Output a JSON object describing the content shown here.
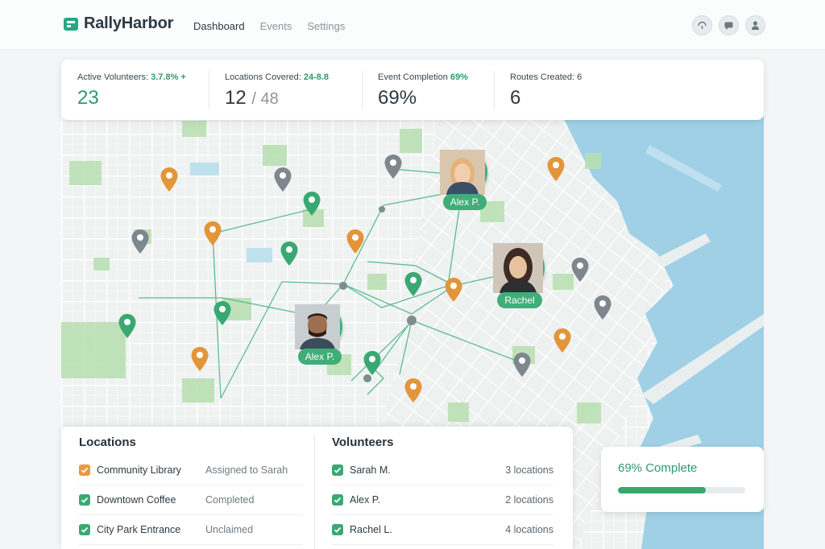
{
  "app": {
    "name": "RallyHarbor"
  },
  "nav": [
    {
      "label": "Dashboard",
      "active": true
    },
    {
      "label": "Events",
      "active": false
    },
    {
      "label": "Settings",
      "active": false
    }
  ],
  "header_icons": [
    "sync-icon",
    "chat-icon",
    "profile-icon"
  ],
  "stats": {
    "volunteers": {
      "label": "Active Volunteers:",
      "trend": "3.7.8% +",
      "value": "23"
    },
    "locations": {
      "label": "Locations Covered:",
      "trend": "24-8.8",
      "value": "12",
      "of": "/ 48"
    },
    "completion": {
      "label": "Event Completion",
      "trend": "69%",
      "value": "69%"
    },
    "routes": {
      "label": "Routes Created:",
      "trend": "6",
      "value": "6"
    }
  },
  "avatars": [
    {
      "tag": "Alex P."
    },
    {
      "tag": "Rachel"
    },
    {
      "tag": "Alex P."
    }
  ],
  "locations": {
    "title": "Locations",
    "items": [
      {
        "name": "Community Library",
        "status": "Assigned to Sarah",
        "state": "assigned"
      },
      {
        "name": "Downtown Coffee",
        "status": "Completed",
        "state": "done"
      },
      {
        "name": "City Park Entrance",
        "status": "Unclaimed",
        "state": "done"
      }
    ]
  },
  "volunteers": {
    "title": "Volunteers",
    "items": [
      {
        "name": "Sarah M.",
        "count": "3 locations"
      },
      {
        "name": "Alex P.",
        "count": "2 locations"
      },
      {
        "name": "Rachel L.",
        "count": "4 locations"
      }
    ]
  },
  "progress": {
    "label": "69% Complete",
    "fraction": 0.69
  },
  "colors": {
    "accent": "#36a76d",
    "pin_green": "#3aa873",
    "pin_orange": "#e3953a",
    "pin_gray": "#7d878d",
    "water": "#9fd0e6"
  }
}
